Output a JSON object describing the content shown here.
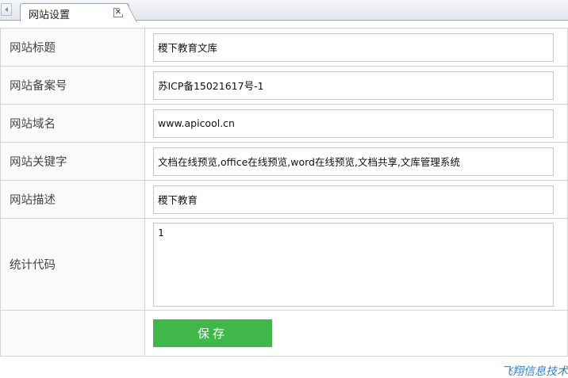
{
  "tab": {
    "title": "网站设置",
    "close_symbol": "✕"
  },
  "form": {
    "fields": [
      {
        "label": "网站标题",
        "value": "稷下教育文库"
      },
      {
        "label": "网站备案号",
        "value": "苏ICP备15021617号-1"
      },
      {
        "label": "网站域名",
        "value": "www.apicool.cn"
      },
      {
        "label": "网站关键字",
        "value": "文档在线预览,office在线预览,word在线预览,文档共享,文库管理系统"
      },
      {
        "label": "网站描述",
        "value": "稷下教育"
      }
    ],
    "stats": {
      "label": "统计代码",
      "value": "1"
    },
    "save_label": "保存"
  },
  "footer": {
    "brand": "飞翔信息技术"
  },
  "colors": {
    "save_button": "#41b64a",
    "brand_text": "#3a7fc4",
    "tab_border": "#9aa7b8"
  }
}
